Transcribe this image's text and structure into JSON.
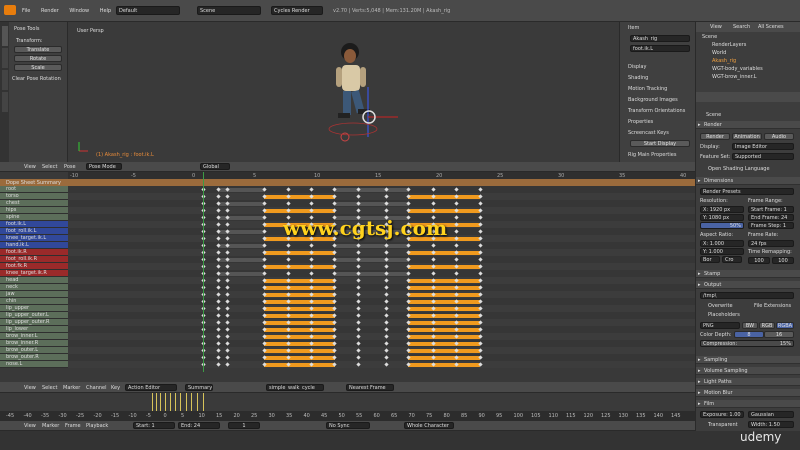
{
  "topbar": {
    "menus": [
      "File",
      "Render",
      "Window",
      "Help"
    ],
    "layout": "Default",
    "scene": "Scene",
    "engine": "Cycles Render",
    "stats": "v2.70 | Verts:5,048 | Mem:131.20M | Akash_rig"
  },
  "tool": {
    "tabs": [
      "Tools",
      "Create",
      "Relations",
      "Animation",
      "Grease Pencil"
    ],
    "header": "Pose Tools",
    "items": [
      "Transform:",
      "Translate",
      "Rotate",
      "Scale"
    ],
    "clear": "Clear Pose Rotation"
  },
  "viewport": {
    "label": "User Persp",
    "bottom_label": "(1) Akash_rig : foot.ik.L",
    "menus": [
      "View",
      "Select",
      "Pose"
    ],
    "mode": "Pose Mode",
    "orientation": "Global"
  },
  "npanel": {
    "item_header": "Item",
    "item1": "Akash_rig",
    "item2": "foot.ik.L",
    "sections": [
      "Display",
      "Shading",
      "Motion Tracking",
      "Background Images",
      "Transform Orientations",
      "Properties",
      "Screencast Keys"
    ],
    "start_display": "Start Display",
    "rig_main": "Rig Main Properties"
  },
  "outliner": {
    "tabs": [
      "View",
      "Search",
      "All Scenes"
    ],
    "items": [
      "Scene",
      "RenderLayers",
      "World",
      "Akash_rig",
      "WGT-body_variables",
      "WGT-brow_inner.L"
    ]
  },
  "props": {
    "scene_label": "Scene",
    "render": "Render",
    "buttons": [
      "Render",
      "Animation",
      "Audio"
    ],
    "display_label": "Display:",
    "display": "Image Editor",
    "feature_label": "Feature Set:",
    "feature": "Supported",
    "osl": "Open Shading Language",
    "dimensions": "Dimensions",
    "presets": "Render Presets",
    "resolution": "Resolution:",
    "res_x": "X: 1920 px",
    "res_y": "Y: 1080 px",
    "res_pct": "50%",
    "frame_range": "Frame Range:",
    "start": "Start Frame: 1",
    "end": "End Frame: 24",
    "step": "Frame Step: 1",
    "aspect": "Aspect Ratio:",
    "ax": "X: 1.000",
    "ay": "Y: 1.000",
    "fps_label": "Frame Rate:",
    "fps": "24 fps",
    "remap": "Time Remapping:",
    "old": "100",
    "new": "100",
    "border": "Bor",
    "crop": "Cro",
    "stamp": "Stamp",
    "output": "Output",
    "path": "/tmp\\",
    "overwrite": "Overwrite",
    "ext": "File Extensions",
    "placeholders": "Placeholders",
    "format": "PNG",
    "bw": "BW",
    "rgb": "RGB",
    "rgba": "RGBA",
    "depth_label": "Color Depth:",
    "d8": "8",
    "d16": "16",
    "compression": "Compression:",
    "comp_val": "15%",
    "sections": [
      "Sampling",
      "Volume Sampling",
      "Light Paths",
      "Motion Blur",
      "Film"
    ],
    "exposure": "Exposure: 1.00",
    "filter": "Gaussian",
    "transparent": "Transparent",
    "width": "Width: 1.50"
  },
  "dopesheet": {
    "summary": "Dope Sheet Summary",
    "channels": [
      {
        "n": "root",
        "c": "g"
      },
      {
        "n": "torso",
        "c": "g"
      },
      {
        "n": "chest",
        "c": "g"
      },
      {
        "n": "hips",
        "c": "g"
      },
      {
        "n": "spine",
        "c": "g"
      },
      {
        "n": "foot.ik.L",
        "c": "b"
      },
      {
        "n": "foot_roll.ik.L",
        "c": "b"
      },
      {
        "n": "knee_target.ik.L",
        "c": "b"
      },
      {
        "n": "hand.ik.L",
        "c": "b"
      },
      {
        "n": "foot.ik.R",
        "c": "r"
      },
      {
        "n": "foot_roll.ik.R",
        "c": "r"
      },
      {
        "n": "foot.fk.R",
        "c": "r"
      },
      {
        "n": "knee_target.ik.R",
        "c": "r"
      },
      {
        "n": "head",
        "c": "g"
      },
      {
        "n": "neck",
        "c": "g"
      },
      {
        "n": "jaw",
        "c": "g"
      },
      {
        "n": "chin",
        "c": "g"
      },
      {
        "n": "lip_upper",
        "c": "g"
      },
      {
        "n": "lip_upper_outer.L",
        "c": "g"
      },
      {
        "n": "lip_upper_outer.R",
        "c": "g"
      },
      {
        "n": "lip_lower",
        "c": "g"
      },
      {
        "n": "brow_inner.L",
        "c": "g"
      },
      {
        "n": "brow_inner.R",
        "c": "g"
      },
      {
        "n": "brow_outer.L",
        "c": "g"
      },
      {
        "n": "brow_outer.R",
        "c": "g"
      },
      {
        "n": "nose.L",
        "c": "g"
      }
    ],
    "ruler": [
      "-10",
      "-5",
      "0",
      "5",
      "10",
      "15",
      "20",
      "25",
      "30",
      "35",
      "40"
    ],
    "menus": [
      "View",
      "Select",
      "Marker",
      "Channel",
      "Key"
    ],
    "editor": "Action Editor",
    "mode": "Summary",
    "action": "simple_walk_cycle",
    "snap": "Nearest Frame"
  },
  "timeline": {
    "ruler": [
      "-45",
      "-40",
      "-35",
      "-30",
      "-25",
      "-20",
      "-15",
      "-10",
      "-5",
      "0",
      "5",
      "10",
      "15",
      "20",
      "25",
      "30",
      "35",
      "40",
      "45",
      "50",
      "55",
      "60",
      "65",
      "70",
      "75",
      "80",
      "85",
      "90",
      "95",
      "100",
      "105",
      "110",
      "115",
      "120",
      "125",
      "130",
      "135",
      "140",
      "145"
    ],
    "menus": [
      "View",
      "Marker",
      "Frame",
      "Playback"
    ],
    "start": "Start: 1",
    "end": "End: 24",
    "current": "1",
    "sync": "No Sync",
    "keying": "Whole Character"
  },
  "watermark": "www.cgtsj.com",
  "brand": "udemy"
}
